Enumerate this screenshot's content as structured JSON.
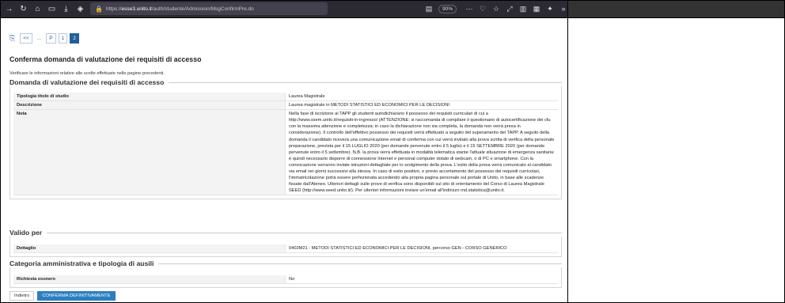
{
  "browser": {
    "url_prefix": "https://",
    "url_domain": "esse3.unito.it",
    "url_path": "/auth/studente/Admission/MsgConfirmPre.do",
    "zoom": "90%"
  },
  "pager": {
    "first": "<<",
    "ellipsis": "...",
    "pages": [
      "P",
      "1",
      "2"
    ]
  },
  "page": {
    "title": "Conferma domanda di valutazione dei requisiti di accesso",
    "subtitle": "Verificare le informazioni relative alle scelte effettuate nelle pagine precedenti."
  },
  "sections": [
    {
      "title": "Domanda di valutazione dei requisiti di accesso",
      "rows": [
        {
          "key": "Tipologia titolo di studio",
          "value": "Laurea Magistrale"
        },
        {
          "key": "Descrizione",
          "value": "Laurea magistrale in METODI STATISTICI ED ECONOMICI PER LE DECISIONI"
        },
        {
          "key": "Nota",
          "value": "Nella fase di iscrizione al TAPP gli studenti autodichiarano il possesso dei requisiti curriculari di cui a http://www.ssem.unito.it/requisiti-in-ingresso/ (ATTENZIONE: si raccomanda di compilare il questionario di autocertificazione dei cfu con la massima attenzione e completezza; in caso la dichiarazione non sia completa, la domanda non verrà presa in considerazione). Il controllo dell'effettivo possesso dei requisiti verrà effettuato a seguito del superamento del TAPP. A seguito della domanda il candidato riceverà una comunicazione email di conferma con cui verrà invitato alla prova scritta di verifica della personale preparazione, prevista per il 15 LUGLIO 2020 (per domande pervenute entro il 5 luglio) e il 15 SETTEMBRE 2020 (per domande pervenute entro il 5 settembre). N.B. la prova verrà effettuata in modalità telematica stante l'attuale situazione di emergenza sanitaria: è quindi necessario disporre di connessione Internet e personal computer dotato di webcam, o di PC e smartphone. Con la convocazione verranno inviate istruzioni dettagliate per lo svolgimento della prova. L'esito della prova verrà comunicato al candidato via email nei giorni successivi alla stessa. In caso di esito positivo, e previo accertamento del possesso dei requisiti curricolari, l'immatricolazione potrà essere perfezionata accedendo alla propria pagina personale sul portale di Unito, in base alle scadenze fissate dall'Ateneo. Ulteriori dettagli sulle prove di verifica sono disponibili sul sito di orientamento del Corso di Laurea Magistrale SEED (http://www.seed.unito.it/). Per ulteriori informazioni inviare un'email all'indirizzo md.statistica@unito.it."
        }
      ]
    },
    {
      "title": "Valido per",
      "rows": [
        {
          "key": "Dettaglio",
          "value": "0402M21 - METODI STATISTICI ED ECONOMICI PER LE DECISIONI, percorso GEN - CORSO GENERICO"
        }
      ]
    },
    {
      "title": "Categoria amministrativa e tipologia di ausili",
      "rows": [
        {
          "key": "Richiesta esonero",
          "value": "No"
        }
      ]
    }
  ],
  "buttons": {
    "back": "Indietro",
    "confirm": "CONFERMA DEFINITIVAMENTE"
  }
}
